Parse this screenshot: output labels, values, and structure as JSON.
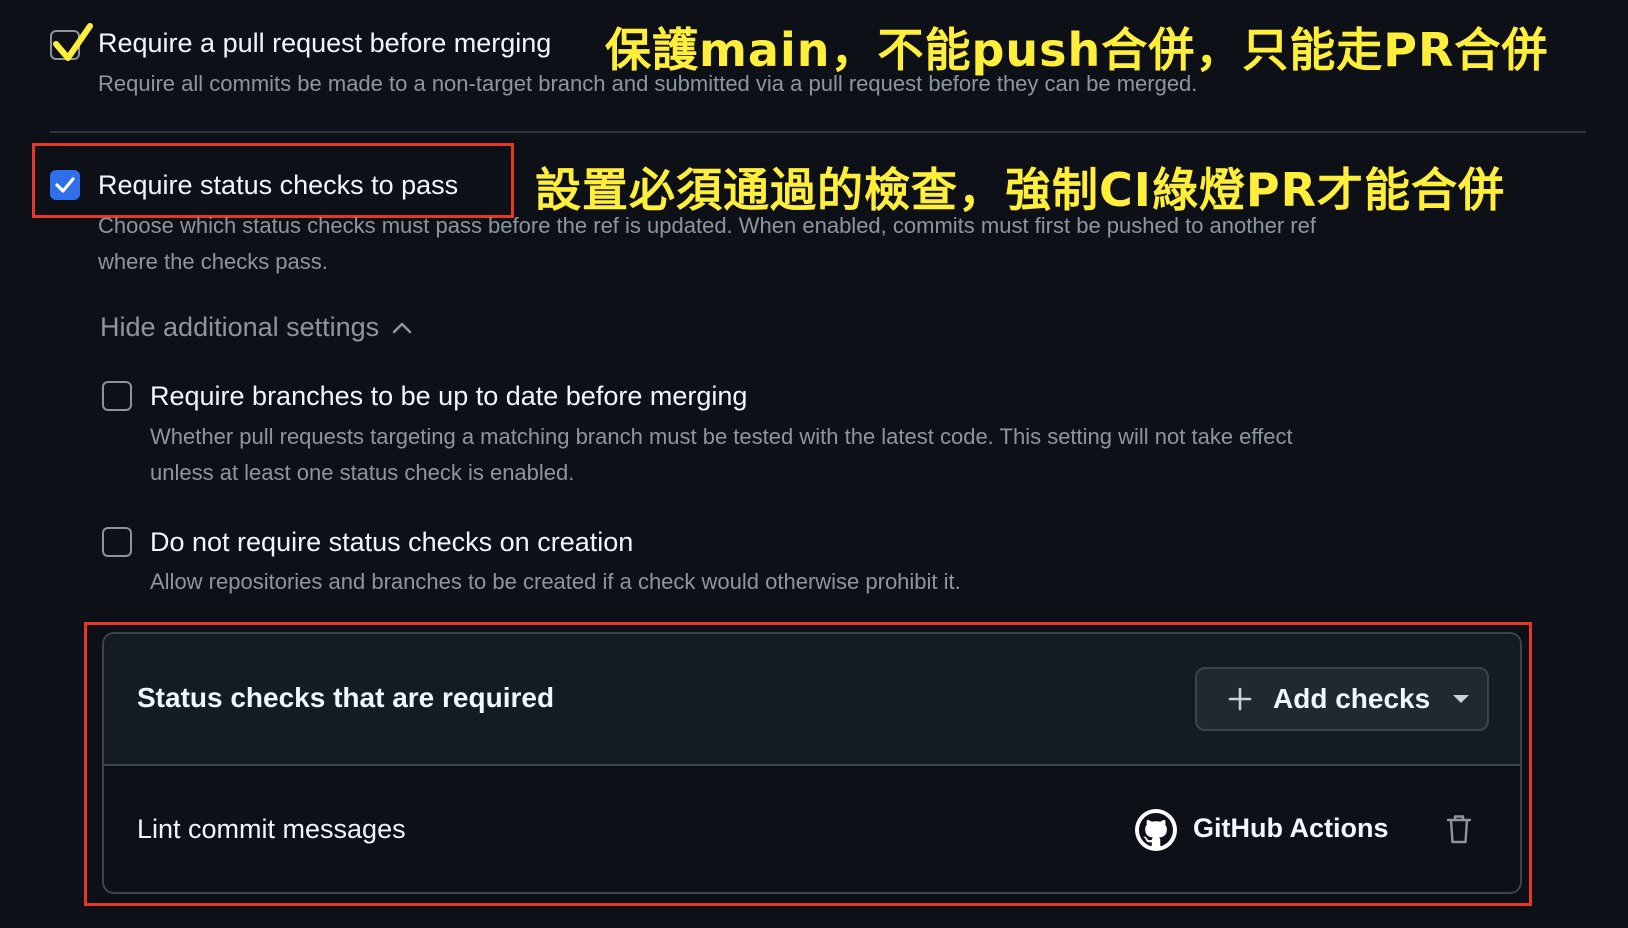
{
  "rules": {
    "require_pr": {
      "label": "Require a pull request before merging",
      "description": "Require all commits be made to a non-target branch and submitted via a pull request before they can be merged.",
      "checked": true
    },
    "require_status_checks": {
      "label": "Require status checks to pass",
      "description_line1": "Choose which status checks must pass before the ref is updated. When enabled, commits must first be pushed to another ref",
      "description_line2": "where the checks pass.",
      "checked": true
    },
    "toggle_label": "Hide additional settings",
    "require_up_to_date": {
      "label": "Require branches to be up to date before merging",
      "description_line1": "Whether pull requests targeting a matching branch must be tested with the latest code. This setting will not take effect",
      "description_line2": "unless at least one status check is enabled.",
      "checked": false
    },
    "no_checks_on_creation": {
      "label": "Do not require status checks on creation",
      "description": "Allow repositories and branches to be created if a check would otherwise prohibit it.",
      "checked": false
    }
  },
  "status_checks_panel": {
    "title": "Status checks that are required",
    "add_button_label": "Add checks",
    "items": [
      {
        "name": "Lint commit messages",
        "source": "GitHub Actions"
      }
    ]
  },
  "annotations": {
    "top": "保護main，不能push合併，只能走PR合併",
    "middle": "設置必須通過的檢查，強制CI綠燈PR才能合併"
  },
  "colors": {
    "accent_blue": "#2f6feb",
    "annotation_yellow": "#ffef3b",
    "highlight_red": "#e5382b",
    "background": "#0d1117"
  }
}
